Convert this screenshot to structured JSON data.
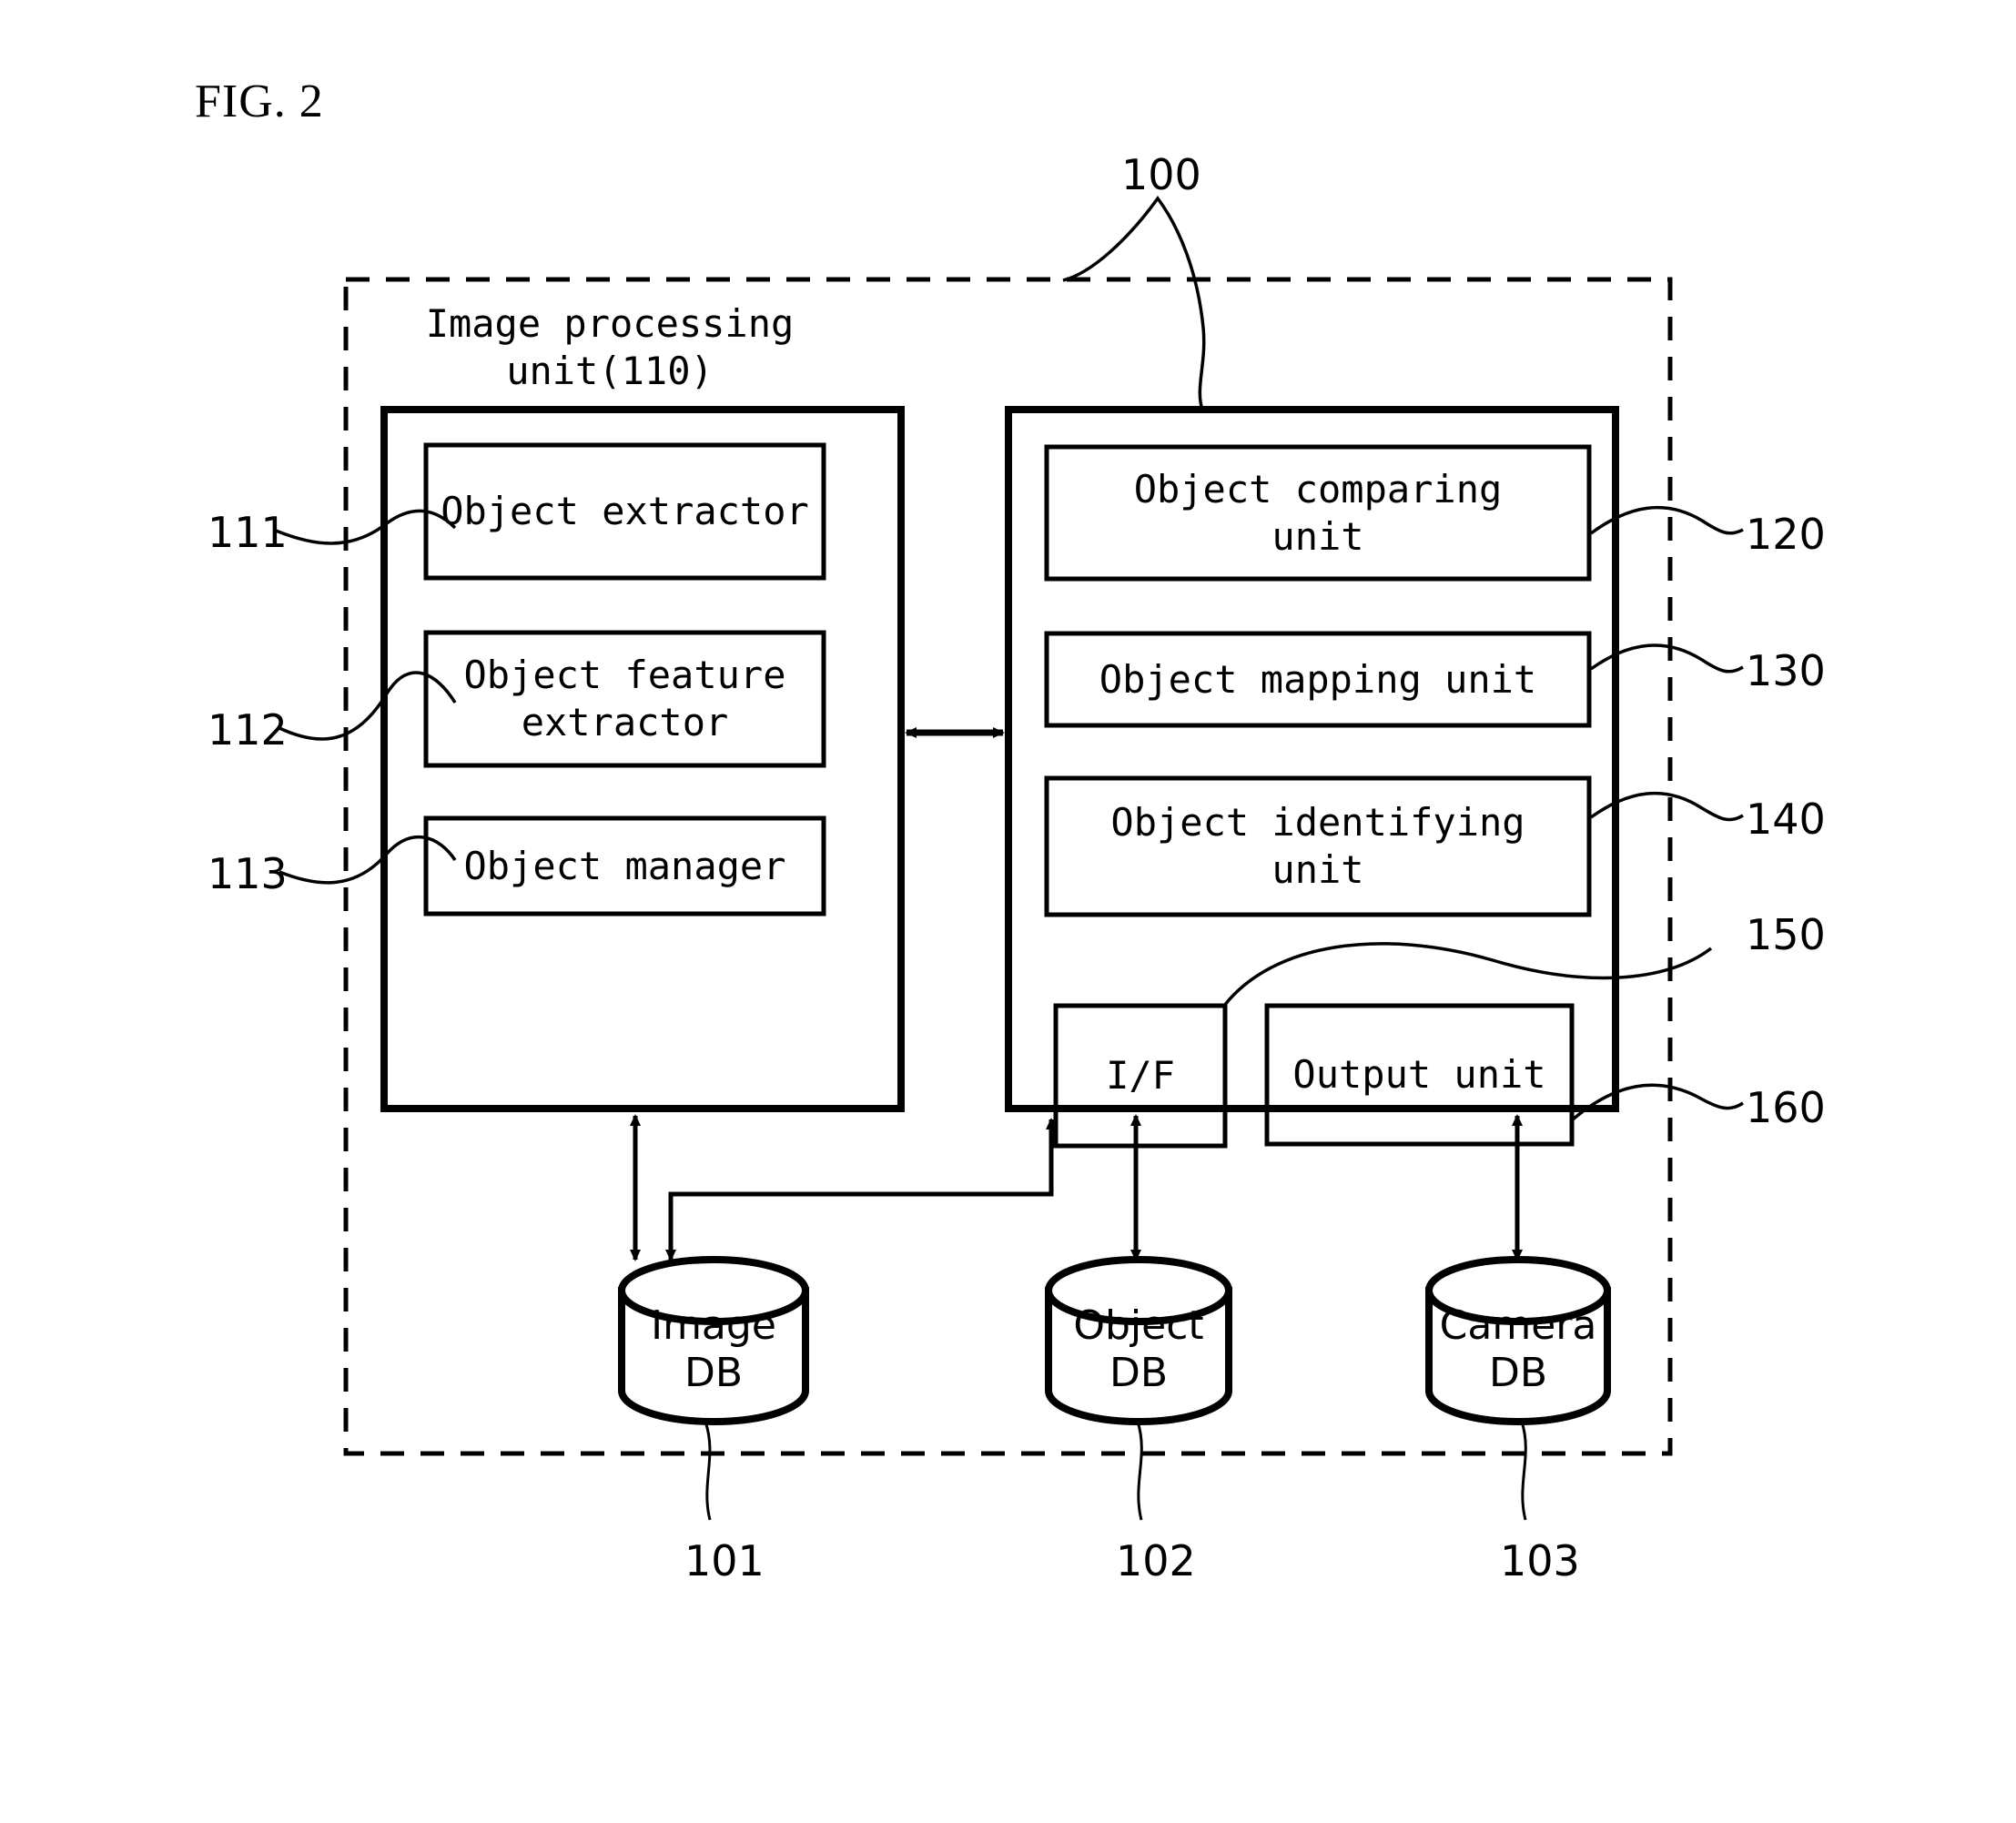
{
  "figure": {
    "caption": "FIG. 2",
    "system_ref": "100"
  },
  "image_processing_unit": {
    "title": "Image processing\nunit(110)",
    "ref": "110",
    "components": [
      {
        "label": "Object extractor",
        "ref": "111"
      },
      {
        "label": "Object feature\nextractor",
        "ref": "112"
      },
      {
        "label": "Object manager",
        "ref": "113"
      }
    ]
  },
  "processing_unit_right": {
    "components": [
      {
        "label": "Object comparing\nunit",
        "ref": "120"
      },
      {
        "label": "Object mapping unit",
        "ref": "130"
      },
      {
        "label": "Object identifying\nunit",
        "ref": "140"
      },
      {
        "label": "I/F",
        "ref": "150"
      },
      {
        "label": "Output unit",
        "ref": "160"
      }
    ]
  },
  "databases": [
    {
      "name": "Image",
      "type": "DB",
      "ref": "101"
    },
    {
      "name": "Object",
      "type": "DB",
      "ref": "102"
    },
    {
      "name": "Camera",
      "type": "DB",
      "ref": "103"
    }
  ],
  "style": {
    "stroke": "#000000",
    "background": "#ffffff"
  }
}
